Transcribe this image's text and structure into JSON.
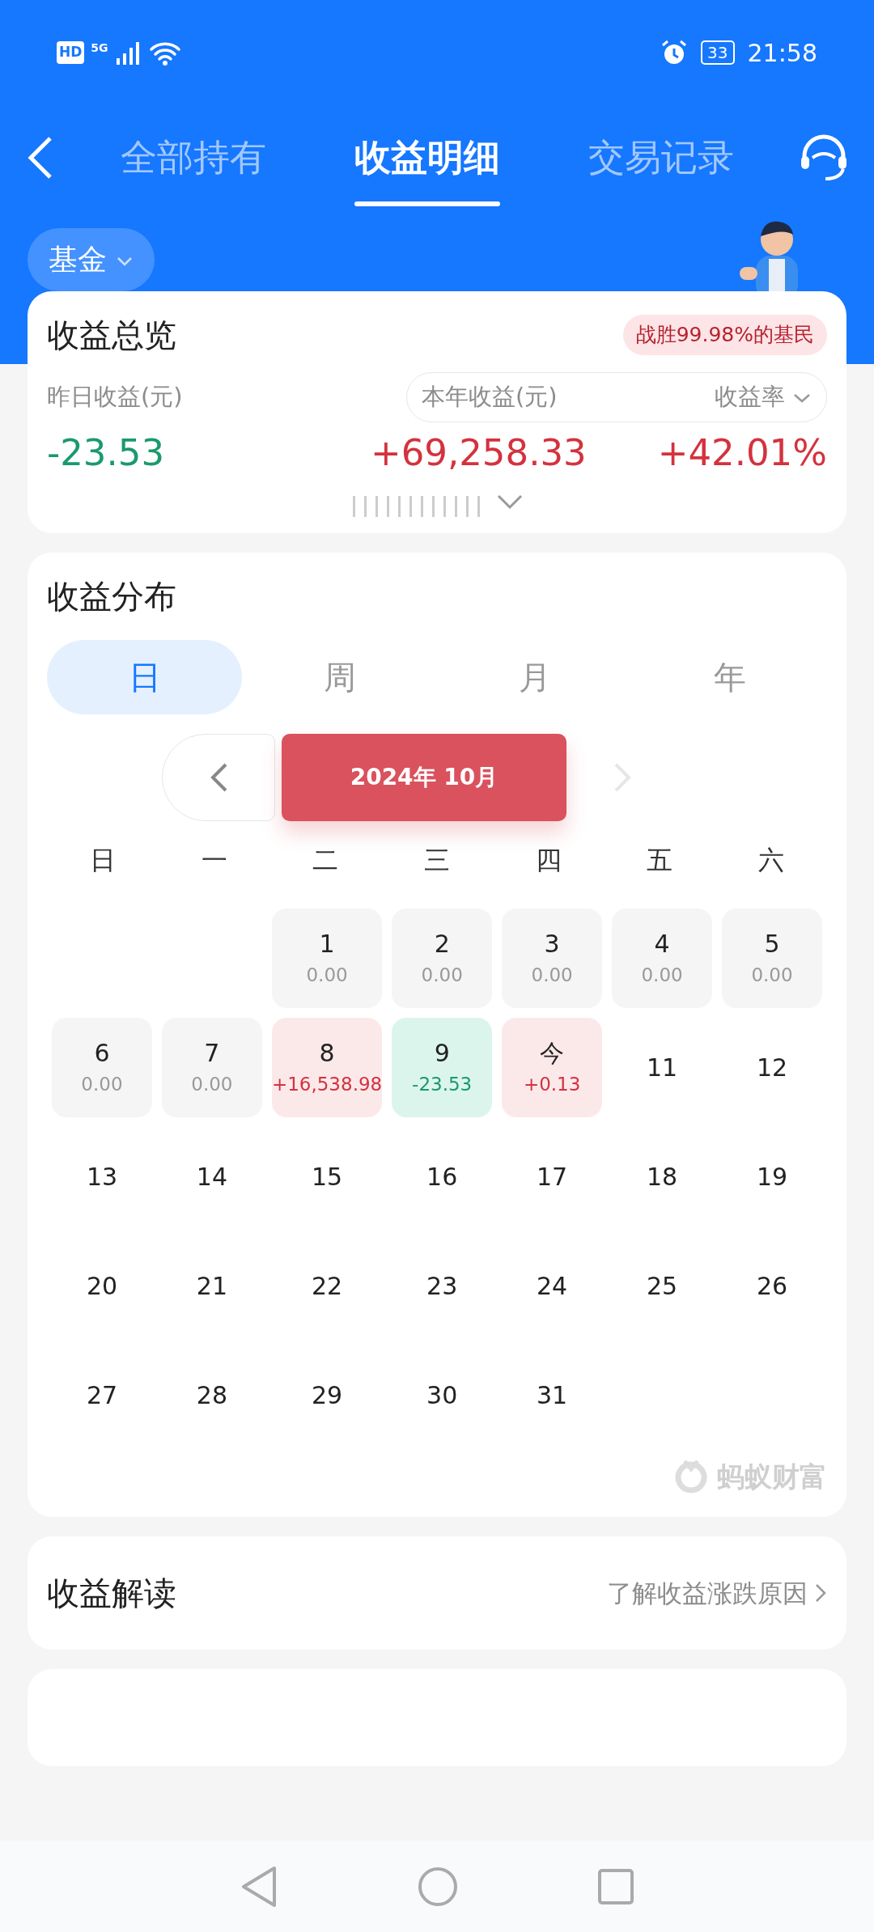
{
  "status_bar": {
    "hd": "HD",
    "network": "5G",
    "battery": "33",
    "time": "21:58"
  },
  "tabs": [
    {
      "label": "全部持有",
      "selected": false
    },
    {
      "label": "收益明细",
      "selected": true
    },
    {
      "label": "交易记录",
      "selected": false
    }
  ],
  "filter": {
    "label": "基金"
  },
  "overview": {
    "title": "收益总览",
    "rank_badge": "战胜99.98%的基民",
    "yesterday_label": "昨日收益(元)",
    "yesterday_value": "-23.53",
    "yesterday_down": true,
    "year_label": "本年收益(元)",
    "rate_dropdown": "收益率",
    "year_value": "+69,258.33",
    "year_down": false,
    "rate_value": "+42.01%",
    "rate_down": false
  },
  "distribution": {
    "title": "收益分布",
    "periods": [
      {
        "label": "日",
        "selected": true
      },
      {
        "label": "周",
        "selected": false
      },
      {
        "label": "月",
        "selected": false
      },
      {
        "label": "年",
        "selected": false
      }
    ],
    "month_label": "2024年 10月",
    "prev_disabled": false,
    "next_disabled": true,
    "weekdays": [
      "日",
      "一",
      "二",
      "三",
      "四",
      "五",
      "六"
    ],
    "days": [
      {
        "kind": "empty"
      },
      {
        "kind": "empty"
      },
      {
        "day": "1",
        "amount": "0.00",
        "kind": "flat"
      },
      {
        "day": "2",
        "amount": "0.00",
        "kind": "flat"
      },
      {
        "day": "3",
        "amount": "0.00",
        "kind": "flat"
      },
      {
        "day": "4",
        "amount": "0.00",
        "kind": "flat"
      },
      {
        "day": "5",
        "amount": "0.00",
        "kind": "flat"
      },
      {
        "day": "6",
        "amount": "0.00",
        "kind": "flat"
      },
      {
        "day": "7",
        "amount": "0.00",
        "kind": "flat"
      },
      {
        "day": "8",
        "amount": "+16,538.98",
        "kind": "gain"
      },
      {
        "day": "9",
        "amount": "-23.53",
        "kind": "loss"
      },
      {
        "day": "今",
        "amount": "+0.13",
        "kind": "gain"
      },
      {
        "day": "11",
        "kind": "future"
      },
      {
        "day": "12",
        "kind": "future"
      },
      {
        "day": "13",
        "kind": "future"
      },
      {
        "day": "14",
        "kind": "future"
      },
      {
        "day": "15",
        "kind": "future"
      },
      {
        "day": "16",
        "kind": "future"
      },
      {
        "day": "17",
        "kind": "future"
      },
      {
        "day": "18",
        "kind": "future"
      },
      {
        "day": "19",
        "kind": "future"
      },
      {
        "day": "20",
        "kind": "future"
      },
      {
        "day": "21",
        "kind": "future"
      },
      {
        "day": "22",
        "kind": "future"
      },
      {
        "day": "23",
        "kind": "future"
      },
      {
        "day": "24",
        "kind": "future"
      },
      {
        "day": "25",
        "kind": "future"
      },
      {
        "day": "26",
        "kind": "future"
      },
      {
        "day": "27",
        "kind": "future"
      },
      {
        "day": "28",
        "kind": "future"
      },
      {
        "day": "29",
        "kind": "future"
      },
      {
        "day": "30",
        "kind": "future"
      },
      {
        "day": "31",
        "kind": "future"
      }
    ],
    "brand": "蚂蚁财富"
  },
  "insight": {
    "title": "收益解读",
    "link": "了解收益涨跌原因"
  }
}
